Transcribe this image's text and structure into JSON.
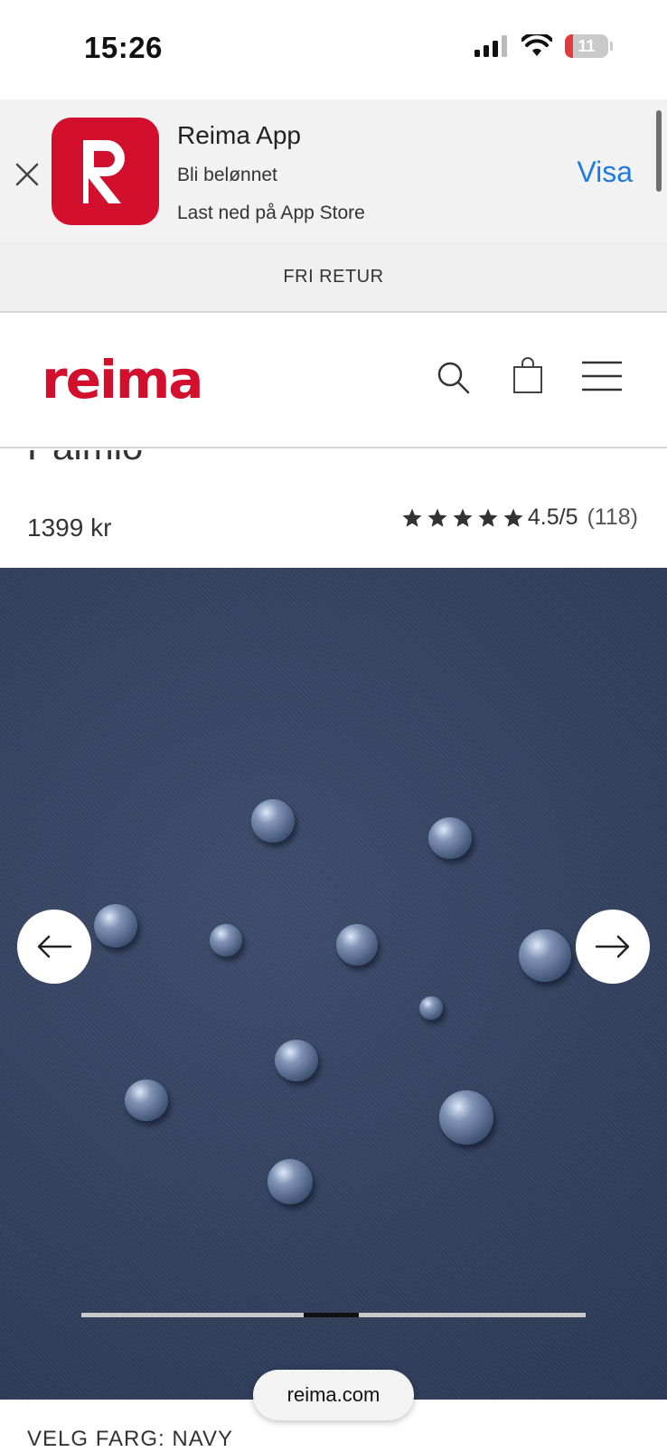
{
  "status_bar": {
    "time": "15:26",
    "battery_level": "11",
    "battery_fraction": 0.11
  },
  "app_banner": {
    "app_name": "Reima App",
    "subtitle": "Bli belønnet",
    "store_text": "Last ned på App Store",
    "action_label": "Visa",
    "accent_color": "#1f7ae0",
    "icon_color": "#d2102e"
  },
  "promo_bar": {
    "text": "FRI RETUR"
  },
  "header": {
    "logo_text": "reima",
    "brand_color": "#d2102e"
  },
  "product": {
    "title": "Paimio",
    "price": "1399 kr",
    "rating_value": "4.5/5",
    "rating_count": "(118)",
    "star_count": 5
  },
  "gallery": {
    "prev_icon": "arrow-left-icon",
    "next_icon": "arrow-right-icon",
    "progress_fraction_start": 0.44,
    "progress_fraction_width": 0.11
  },
  "browser": {
    "url": "reima.com"
  },
  "color_selector": {
    "label": "VELG FARG: NAVY"
  }
}
